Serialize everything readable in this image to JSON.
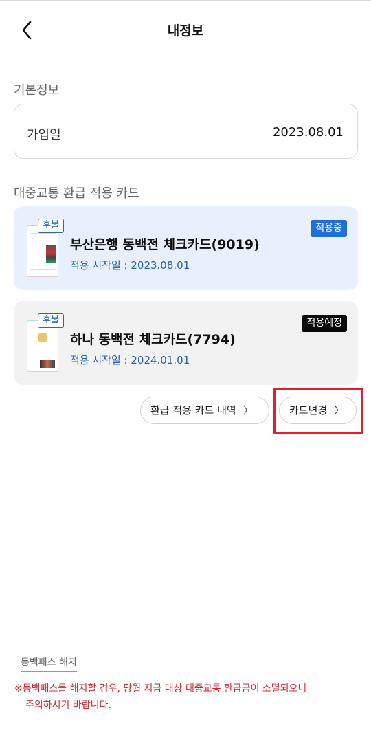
{
  "header": {
    "title": "내정보",
    "back_icon": "chevron-left-icon"
  },
  "basic_info": {
    "section_title": "기본정보",
    "join_label": "가입일",
    "join_date": "2023.08.01"
  },
  "transit_cards": {
    "section_title": "대중교통 환급 적용 카드",
    "items": [
      {
        "badge": "후불",
        "name": "부산은행 동백전 체크카드(9019)",
        "date_text": "적용 시작일 : 2023.08.01",
        "status": "적용중",
        "status_color": "#1e6fd9"
      },
      {
        "badge": "후불",
        "name": "하나 동백전 체크카드(7794)",
        "date_text": "적용 시작일 : 2024.01.01",
        "status": "적용예정",
        "status_color": "#0a0a0a"
      }
    ]
  },
  "actions": {
    "history_label": "환급 적용 카드 내역",
    "change_label": "카드변경",
    "chevron_icon": "chevron-right-icon"
  },
  "footer": {
    "cancel_label": "동백패스 해지",
    "notice_line1": "※동백패스를 해지할 경우, 당월 지급 대상 대중교통 환급금이 소멸되오니",
    "notice_line2": "주의하시기 바랍니다."
  },
  "colors": {
    "accent_blue": "#2563ad",
    "highlight_red": "#e0202a",
    "notice_red": "#d2272e"
  }
}
